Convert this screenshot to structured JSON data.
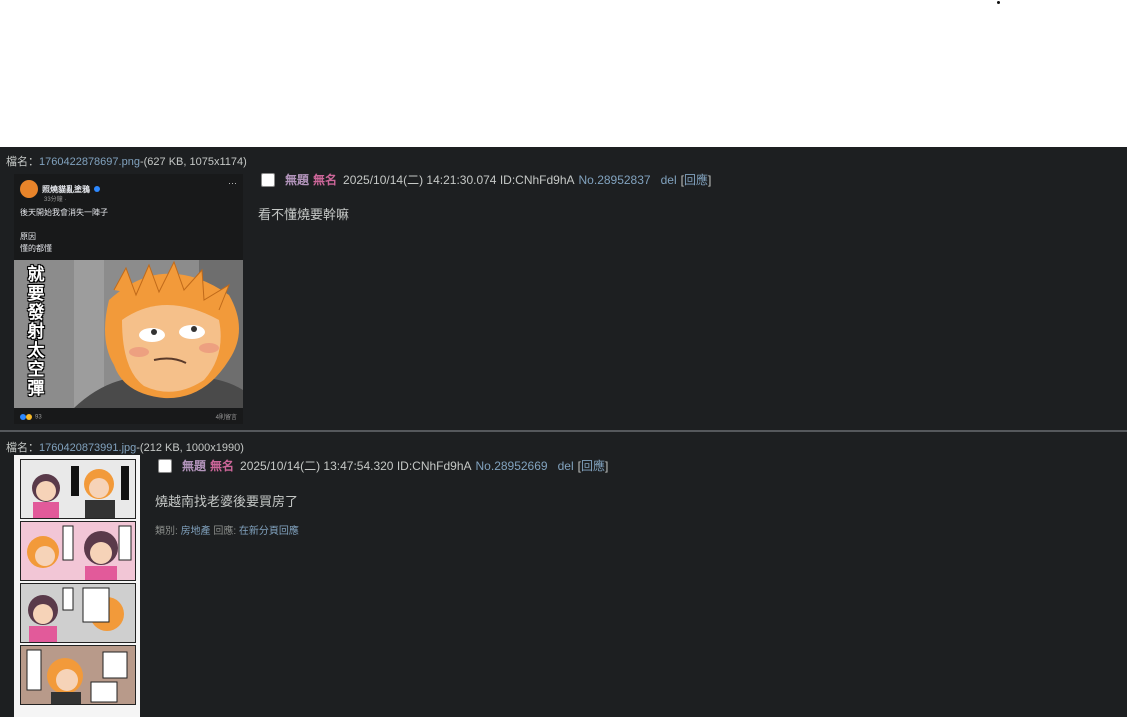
{
  "posts": [
    {
      "file_label": "檔名：",
      "file_name": "1760422878697.png",
      "file_meta": "-(627 KB, 1075x1174)",
      "title": "無題",
      "name": "無名",
      "datetime": "2025/10/14(二) 14:21:30.074 ID:CNhFd9hA",
      "post_no": "No.28952837",
      "del": "del",
      "reply_open": "[",
      "reply": "回應",
      "reply_close": "]",
      "message": "看不懂燒要幹嘛",
      "thumb": {
        "author": "照燒貓亂塗鴉",
        "time": "33分鐘 · ",
        "line1": "後天開始我會消失一陣子",
        "line2": "原因",
        "line3": "懂的都懂",
        "vertical_text": "就要發射太空彈",
        "reactions": "93",
        "comments": "4則留言"
      }
    },
    {
      "file_label": "檔名：",
      "file_name": "1760420873991.jpg",
      "file_meta": "-(212 KB, 1000x1990)",
      "title": "無題",
      "name": "無名",
      "datetime": "2025/10/14(二) 13:47:54.320 ID:CNhFd9hA",
      "post_no": "No.28952669",
      "del": "del",
      "reply_open": "[",
      "reply": "回應",
      "reply_close": "]",
      "message": "燒越南找老婆後要買房了",
      "category_label": "類別: ",
      "category": "房地產",
      "reply_label": " 回應: ",
      "reply_new_page": "在新分頁回應"
    }
  ]
}
